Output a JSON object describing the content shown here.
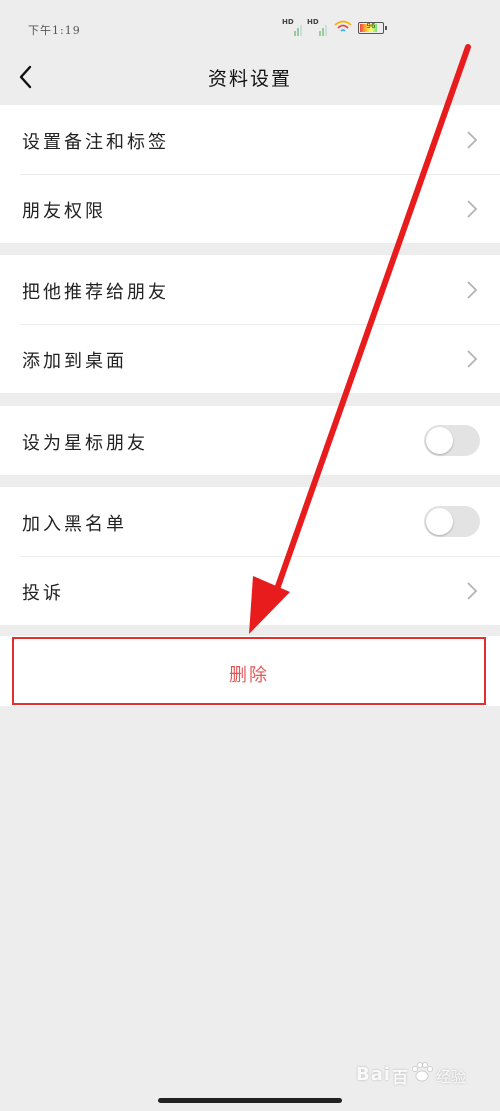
{
  "status_bar": {
    "time": "下午1:19",
    "signal_1": "HD",
    "signal_2": "HD",
    "battery": "96"
  },
  "header": {
    "back_icon": "chevron-left-icon",
    "title": "资料设置"
  },
  "groups": [
    {
      "items": [
        {
          "label": "设置备注和标签",
          "control": "chevron-right-icon"
        },
        {
          "label": "朋友权限",
          "control": "chevron-right-icon"
        }
      ]
    },
    {
      "items": [
        {
          "label": "把他推荐给朋友",
          "control": "chevron-right-icon"
        },
        {
          "label": "添加到桌面",
          "control": "chevron-right-icon"
        }
      ]
    },
    {
      "items": [
        {
          "label": "设为星标朋友",
          "control": "toggle",
          "state": "off"
        }
      ]
    },
    {
      "items": [
        {
          "label": "加入黑名单",
          "control": "toggle",
          "state": "off"
        },
        {
          "label": "投诉",
          "control": "chevron-right-icon"
        }
      ]
    }
  ],
  "delete": {
    "label": "删除"
  },
  "watermark": {
    "brand": "Bai",
    "brand_end": "百",
    "suffix": "经验"
  },
  "colors": {
    "background": "#ededed",
    "delete_text": "#e55757",
    "highlight": "#e03030",
    "arrow": "#e81c1c",
    "toggle_off": "#e3e3e3"
  }
}
